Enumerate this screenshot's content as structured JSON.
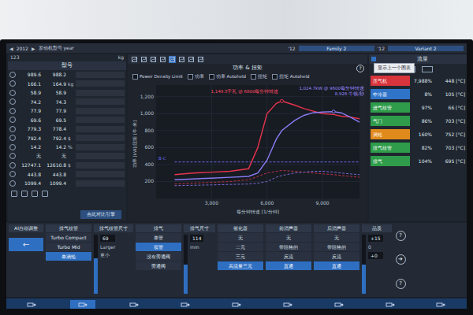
{
  "topbar": {
    "prev": "◀",
    "year": "2012",
    "next": "▶",
    "engine_label": "发动机型号 year",
    "family_year": "'12",
    "family": "Family 2",
    "variant_year": "'12",
    "variant": "Variant 2"
  },
  "stats": {
    "count": "123",
    "unit": "kg",
    "title": "型号",
    "rows": [
      {
        "a": "989.6",
        "b": "988.2",
        "unit": ""
      },
      {
        "a": "166.1",
        "b": "164.9",
        "unit": "kg"
      },
      {
        "a": "58.9",
        "b": "58.9",
        "unit": ""
      },
      {
        "a": "74.2",
        "b": "74.3",
        "unit": ""
      },
      {
        "a": "77.9",
        "b": "77.9",
        "unit": ""
      },
      {
        "a": "69.6",
        "b": "69.5",
        "unit": ""
      },
      {
        "a": "779.3",
        "b": "778.4",
        "unit": ""
      },
      {
        "a": "792.4",
        "b": "792.4",
        "unit": "$"
      },
      {
        "a": "14.2",
        "b": "14.2",
        "unit": "%"
      },
      {
        "a": "无",
        "b": "无",
        "unit": ""
      },
      {
        "a": "12747.1",
        "b": "12610.8",
        "unit": "$"
      },
      {
        "a": "443.8",
        "b": "443.8",
        "unit": ""
      },
      {
        "a": "1099.4",
        "b": "1099.4",
        "unit": ""
      }
    ],
    "compare_button": "点此对比引擎"
  },
  "chart": {
    "toolbar": [
      {
        "selected": false
      },
      {
        "selected": false
      },
      {
        "selected": false
      },
      {
        "selected": false
      },
      {
        "selected": true
      },
      {
        "selected": false
      },
      {
        "selected": false
      },
      {
        "selected": false
      }
    ],
    "title": "功率 & 扭矩",
    "help": "?",
    "y_label": "功率 [kW]/扭矩 [牛·米]",
    "x_label": "每分钟转速 [1/分钟]",
    "y_ticks": [
      "200",
      "400",
      "600",
      "800",
      "1,000",
      "1,200"
    ],
    "x_ticks": [
      "3,000",
      "6,000",
      "9,000"
    ],
    "limit_label": "B-C",
    "rpm": [
      1000,
      2000,
      3000,
      4000,
      5000,
      5500,
      6000,
      6500,
      6800,
      7500,
      8000,
      8500,
      9000,
      9600,
      10000,
      10500,
      11000
    ],
    "series": [
      {
        "label": "Power Density Limit",
        "checked": false,
        "color": "#6a6cf0",
        "dashed": true,
        "values": [
          430,
          430,
          430,
          430,
          430,
          430,
          430,
          430,
          430,
          430,
          430,
          430,
          430,
          430,
          430,
          430,
          430
        ]
      },
      {
        "label": "功率",
        "checked": false,
        "color": "#e8344e",
        "dashed": false,
        "values": [
          280,
          300,
          310,
          320,
          350,
          600,
          1000,
          1120,
          1149,
          1100,
          1060,
          1030,
          1000,
          990,
          970,
          960,
          940
        ]
      },
      {
        "label": "功率 Autoheld",
        "checked": false,
        "color": "#8a7cf6",
        "dashed": false,
        "values": [
          220,
          230,
          240,
          250,
          260,
          300,
          450,
          700,
          800,
          920,
          980,
          1010,
          1020,
          1024,
          1010,
          960,
          900
        ]
      },
      {
        "label": "扭矩",
        "checked": false,
        "color": "#c2304a",
        "dashed": true,
        "values": [
          170,
          180,
          190,
          200,
          220,
          260,
          300,
          320,
          330,
          320,
          310,
          300,
          290,
          280,
          270,
          260,
          250
        ]
      },
      {
        "label": "扭矩 Autoheld",
        "checked": false,
        "color": "#7a6ad8",
        "dashed": true,
        "values": [
          150,
          155,
          160,
          165,
          170,
          180,
          200,
          250,
          270,
          300,
          310,
          320,
          320,
          310,
          300,
          290,
          280
        ]
      }
    ],
    "annotations": [
      {
        "text": "1,149.5千瓦 @ 6800每分钟转速",
        "color": "#ff4a64",
        "series": 1
      },
      {
        "text": "1,024.7kW @ 9600每分钟转速",
        "color": "#9c8cff",
        "series": 2
      },
      {
        "text": "8.926 牛顿/秒",
        "color": "#9c8cff",
        "series": 2
      }
    ]
  },
  "flow": {
    "title": "流量",
    "tooltip": "显示上一个图表",
    "rows": [
      {
        "name": "压气机",
        "percent": "7,988%",
        "temp": "448 [°C]",
        "color": "#d8343c"
      },
      {
        "name": "中冷器",
        "percent": "8%",
        "temp": "105 [°C]",
        "color": "#2f74c8"
      },
      {
        "name": "进气歧管",
        "percent": "97%",
        "temp": "66 [°C]",
        "color": "#2e9c4a"
      },
      {
        "name": "气门",
        "percent": "86%",
        "temp": "703 [°C]",
        "color": "#2e9c4a"
      },
      {
        "name": "涡轮",
        "percent": "160%",
        "temp": "752 [°C]",
        "color": "#e08a1c"
      },
      {
        "name": "排气歧管",
        "percent": "82%",
        "temp": "703 [°C]",
        "color": "#2e9c4a"
      },
      {
        "name": "排气",
        "percent": "104%",
        "temp": "695 [°C]",
        "color": "#2e9c4a"
      }
    ]
  },
  "config": {
    "ai": {
      "title": "AI自动调整",
      "arrow": "←"
    },
    "turbo": {
      "title": "排气歧管",
      "options": [
        {
          "label": "Turbo Compact",
          "selected": false
        },
        {
          "label": "Turbo Mid",
          "selected": false
        },
        {
          "label": "单涡轮",
          "selected": true
        }
      ]
    },
    "manifold_size": {
      "title": "排气歧管尺寸",
      "value": "69",
      "larger": "Larger",
      "smaller": "更小",
      "level": 0.6
    },
    "exhaust": {
      "title": "排气",
      "options": [
        {
          "label": "单管",
          "selected": false
        },
        {
          "label": "双管",
          "selected": true
        },
        {
          "label": "没有旁通阀",
          "selected": false
        },
        {
          "label": "旁通阀",
          "selected": false
        }
      ]
    },
    "exhaust_size": {
      "title": "排气尺寸",
      "value": "114",
      "unit": "mm",
      "level": 0.5
    },
    "catalyst": {
      "title": "催化器",
      "options": [
        {
          "label": "无",
          "selected": false
        },
        {
          "label": "二元",
          "selected": false
        },
        {
          "label": "三元",
          "selected": false
        },
        {
          "label": "高流量三元",
          "selected": true
        }
      ]
    },
    "front_muffler": {
      "title": "前消声器",
      "options": [
        {
          "label": "无",
          "selected": false
        },
        {
          "label": "带阻格的",
          "selected": false
        },
        {
          "label": "反流",
          "selected": false
        },
        {
          "label": "直通",
          "selected": true
        }
      ]
    },
    "rear_muffler": {
      "title": "后消声器",
      "options": [
        {
          "label": "无",
          "selected": false
        },
        {
          "label": "带阻格的",
          "selected": false
        },
        {
          "label": "反流",
          "selected": false
        },
        {
          "label": "直通",
          "selected": true
        }
      ]
    },
    "quality": {
      "title": "品质",
      "top": "+15",
      "value": "0",
      "bottom": "+0",
      "level": 0.5
    },
    "side_buttons": [
      "?",
      "➜",
      "?"
    ]
  },
  "nav": [
    {
      "selected": false
    },
    {
      "selected": true
    },
    {
      "selected": false
    },
    {
      "selected": false
    },
    {
      "selected": false
    },
    {
      "selected": false
    },
    {
      "selected": false
    },
    {
      "selected": false
    },
    {
      "selected": false
    }
  ]
}
